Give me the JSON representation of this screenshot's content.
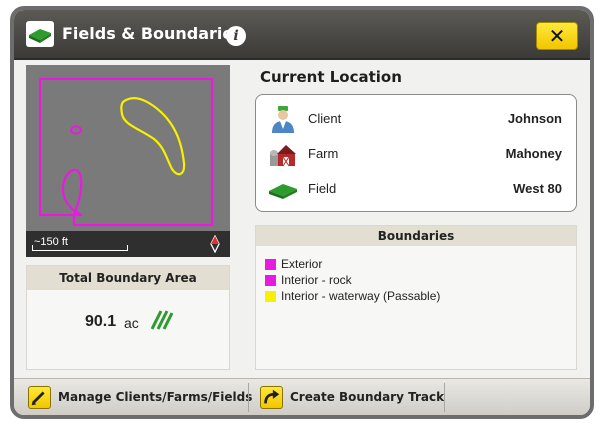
{
  "dialog": {
    "title": "Fields & Boundaries",
    "info_icon_glyph": "i",
    "close_glyph": "✕"
  },
  "map": {
    "scale_label": "~150 ft",
    "north_icon": "north-arrow-icon",
    "exterior_color": "#e81ae0",
    "interior_rock_color": "#e81ae0",
    "waterway_color": "#f7f000",
    "background_color": "#7a7a7a"
  },
  "total_area": {
    "header": "Total Boundary Area",
    "value": "90.1",
    "unit": "ac",
    "icon": "hatched-area-icon"
  },
  "current_location": {
    "title": "Current Location",
    "rows": [
      {
        "label": "Client",
        "value": "Johnson",
        "icon": "client-person-icon"
      },
      {
        "label": "Farm",
        "value": "Mahoney",
        "icon": "farm-barn-icon"
      },
      {
        "label": "Field",
        "value": "West 80",
        "icon": "field-icon"
      }
    ]
  },
  "boundaries": {
    "header": "Boundaries",
    "items": [
      {
        "label": "Exterior",
        "color": "#e81ae0"
      },
      {
        "label": "Interior - rock",
        "color": "#e81ae0"
      },
      {
        "label": "Interior - waterway (Passable)",
        "color": "#f7f000"
      }
    ]
  },
  "bottom_bar": {
    "manage_label": "Manage Clients/Farms/Fields",
    "manage_icon": "pencil-icon",
    "create_label": "Create Boundary Track",
    "create_icon": "curved-arrow-icon"
  },
  "colors": {
    "accent_yellow": "#f2c500",
    "title_bar": "#3b3a37",
    "field_green": "#2e9b2e"
  }
}
